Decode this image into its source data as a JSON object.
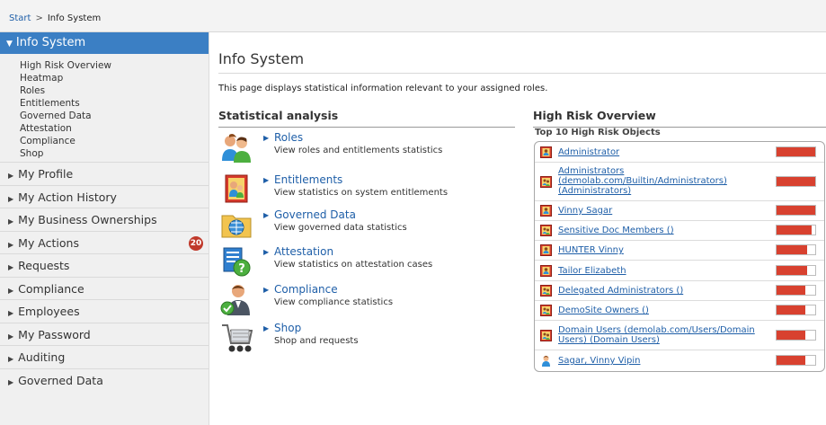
{
  "breadcrumb": {
    "start": "Start",
    "separator": ">",
    "current": "Info System"
  },
  "sidebar": {
    "active": {
      "label": "Info System",
      "subitems": [
        "High Risk Overview",
        "Heatmap",
        "Roles",
        "Entitlements",
        "Governed Data",
        "Attestation",
        "Compliance",
        "Shop"
      ]
    },
    "items": [
      {
        "label": "My Profile",
        "badge": ""
      },
      {
        "label": "My Action History",
        "badge": ""
      },
      {
        "label": "My Business Ownerships",
        "badge": ""
      },
      {
        "label": "My Actions",
        "badge": "20"
      },
      {
        "label": "Requests",
        "badge": ""
      },
      {
        "label": "Compliance",
        "badge": ""
      },
      {
        "label": "Employees",
        "badge": ""
      },
      {
        "label": "My Password",
        "badge": ""
      },
      {
        "label": "Auditing",
        "badge": ""
      },
      {
        "label": "Governed Data",
        "badge": ""
      }
    ]
  },
  "main": {
    "title": "Info System",
    "description": "This page displays statistical information relevant to your assigned roles.",
    "stat_heading": "Statistical analysis",
    "stats": [
      {
        "icon": "roles-people-icon",
        "link": "Roles",
        "sub": "View roles and entitlements statistics"
      },
      {
        "icon": "entitlements-icon",
        "link": "Entitlements",
        "sub": "View statistics on system entitlements"
      },
      {
        "icon": "governed-data-icon",
        "link": "Governed Data",
        "sub": "View governed data statistics"
      },
      {
        "icon": "attestation-icon",
        "link": "Attestation",
        "sub": "View statistics on attestation cases"
      },
      {
        "icon": "compliance-icon",
        "link": "Compliance",
        "sub": "View compliance statistics"
      },
      {
        "icon": "shop-cart-icon",
        "link": "Shop",
        "sub": "Shop and requests"
      }
    ],
    "risk_heading": "High Risk Overview",
    "risk_subheading": "Top 10 High Risk Objects",
    "risk_items": [
      {
        "icon": "role-icon",
        "name": "Administrator",
        "risk": 1.0
      },
      {
        "icon": "group-icon",
        "name": "Administrators (demolab.com/Builtin/Administrators) (Administrators)",
        "risk": 1.0
      },
      {
        "icon": "role-icon",
        "name": "Vinny Sagar",
        "risk": 1.0
      },
      {
        "icon": "group-icon",
        "name": "Sensitive Doc Members ()",
        "risk": 0.9
      },
      {
        "icon": "role-icon",
        "name": "HUNTER Vinny",
        "risk": 0.8
      },
      {
        "icon": "role-icon",
        "name": "Tailor Elizabeth",
        "risk": 0.8
      },
      {
        "icon": "group-icon",
        "name": "Delegated Administrators ()",
        "risk": 0.75
      },
      {
        "icon": "group-icon",
        "name": "DemoSite Owners ()",
        "risk": 0.75
      },
      {
        "icon": "group-icon",
        "name": "Domain Users (demolab.com/Users/Domain Users) (Domain Users)",
        "risk": 0.75
      },
      {
        "icon": "person-icon",
        "name": "Sagar, Vinny Vipin",
        "risk": 0.75
      }
    ]
  },
  "colors": {
    "accent": "#3b7fc4",
    "link": "#1f5fa8",
    "risk": "#d8412f",
    "badge": "#c0392b"
  }
}
